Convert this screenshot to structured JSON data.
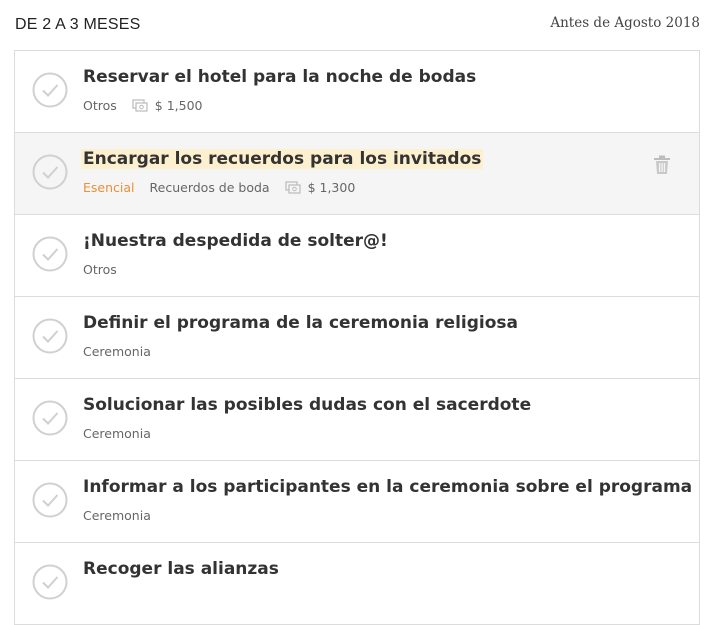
{
  "section": {
    "title": "DE 2 A 3 MESES",
    "date": "Antes de Agosto 2018"
  },
  "icons": {
    "check": "check-circle-icon",
    "budget": "money-icon",
    "delete": "trash-icon"
  },
  "colors": {
    "essential": "#e8913a",
    "highlight": "#fdf0cf",
    "hover_row": "#f5f5f5"
  },
  "tasks": [
    {
      "title": "Reservar el hotel para la noche de bodas",
      "category": "Otros",
      "budget": "$ 1,500"
    },
    {
      "title": "Encargar los recuerdos para los invitados",
      "tag": "Esencial",
      "category": "Recuerdos de boda",
      "budget": "$ 1,300"
    },
    {
      "title": "¡Nuestra despedida de solter@!",
      "category": "Otros"
    },
    {
      "title": "Definir el programa de la ceremonia religiosa",
      "category": "Ceremonia"
    },
    {
      "title": "Solucionar las posibles dudas con el sacerdote",
      "category": "Ceremonia"
    },
    {
      "title": "Informar a los participantes en la ceremonia sobre el programa",
      "category": "Ceremonia"
    },
    {
      "title": "Recoger las alianzas",
      "category": ""
    }
  ]
}
